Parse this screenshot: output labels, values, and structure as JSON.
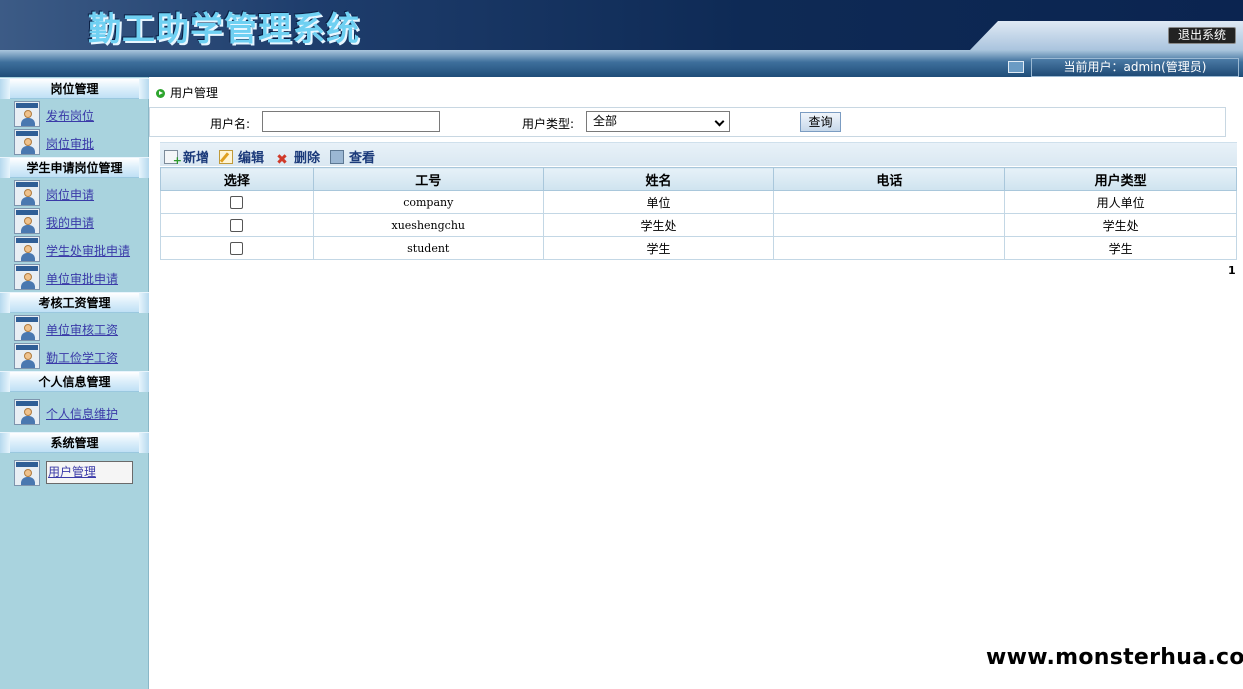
{
  "header": {
    "title": "勤工助学管理系统",
    "logout_label": "退出系统",
    "current_user": "当前用户：admin(管理员)"
  },
  "sidebar": {
    "groups": [
      {
        "title": "岗位管理",
        "items": [
          "发布岗位",
          "岗位审批"
        ]
      },
      {
        "title": "学生申请岗位管理",
        "items": [
          "岗位申请",
          "我的申请",
          "学生处审批申请",
          "单位审批申请"
        ]
      },
      {
        "title": "考核工资管理",
        "items": [
          "单位审核工资",
          "勤工俭学工资"
        ]
      },
      {
        "title": "个人信息管理",
        "items": [
          "个人信息维护"
        ]
      },
      {
        "title": "系统管理",
        "items": [
          "用户管理"
        ]
      }
    ],
    "active_item": "用户管理"
  },
  "main": {
    "breadcrumb": "用户管理",
    "search": {
      "username_label": "用户名:",
      "username_value": "",
      "usertype_label": "用户类型:",
      "usertype_selected": "全部",
      "query_label": "查询"
    },
    "toolbar": {
      "add": "新增",
      "edit": "编辑",
      "delete": "删除",
      "view": "查看"
    },
    "table": {
      "columns": [
        "选择",
        "工号",
        "姓名",
        "电话",
        "用户类型"
      ],
      "rows": [
        {
          "checked": false,
          "id": "company",
          "name": "单位",
          "phone": "",
          "type": "用人单位"
        },
        {
          "checked": false,
          "id": "xueshengchu",
          "name": "学生处",
          "phone": "",
          "type": "学生处"
        },
        {
          "checked": false,
          "id": "student",
          "name": "学生",
          "phone": "",
          "type": "学生"
        }
      ]
    },
    "page_number": "1"
  },
  "watermark": "www.monsterhua.com"
}
